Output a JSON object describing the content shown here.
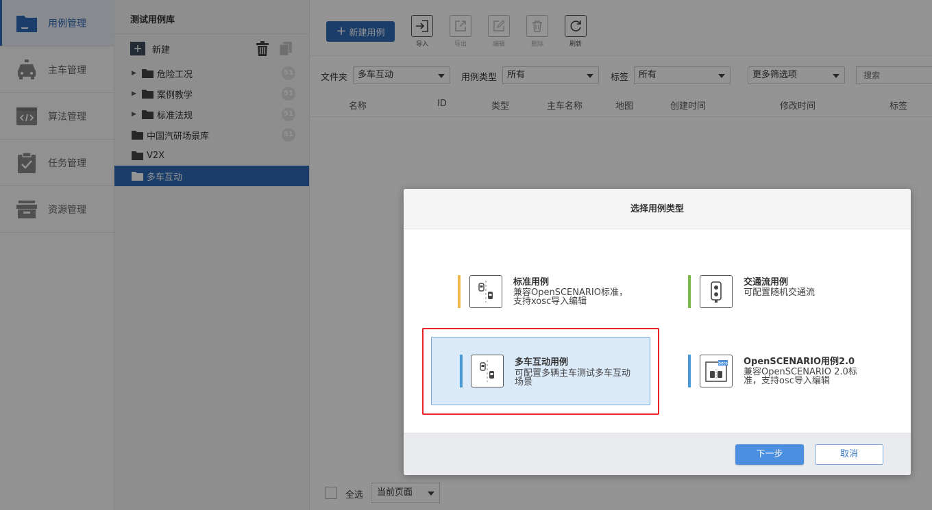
{
  "nav": {
    "items": [
      {
        "label": "用例管理",
        "icon": "folder-icon",
        "active": true
      },
      {
        "label": "主车管理",
        "icon": "car-icon",
        "active": false
      },
      {
        "label": "算法管理",
        "icon": "code-icon",
        "active": false
      },
      {
        "label": "任务管理",
        "icon": "clipboard-check-icon",
        "active": false
      },
      {
        "label": "资源管理",
        "icon": "archive-box-icon",
        "active": false
      }
    ]
  },
  "tree": {
    "title": "测试用例库",
    "new_label": "新建",
    "items": [
      {
        "label": "危险工况",
        "badge": "51",
        "expandable": true
      },
      {
        "label": "案例教学",
        "badge": "51",
        "expandable": true
      },
      {
        "label": "标准法规",
        "badge": "51",
        "expandable": true
      },
      {
        "label": "中国汽研场景库",
        "badge": "51",
        "expandable": false
      },
      {
        "label": "V2X",
        "badge": "",
        "expandable": false
      },
      {
        "label": "多车互动",
        "badge": "",
        "expandable": false,
        "active": true
      }
    ]
  },
  "toolbar": {
    "new_case": "新建用例",
    "tools": [
      {
        "label": "导入",
        "icon": "import-icon",
        "enabled": true
      },
      {
        "label": "导出",
        "icon": "export-icon",
        "enabled": false
      },
      {
        "label": "编辑",
        "icon": "edit-icon",
        "enabled": false
      },
      {
        "label": "删除",
        "icon": "trash-icon",
        "enabled": false
      },
      {
        "label": "刷新",
        "icon": "refresh-icon",
        "enabled": true
      }
    ]
  },
  "filters": {
    "folder_label": "文件夹",
    "folder_value": "多车互动",
    "type_label": "用例类型",
    "type_value": "所有",
    "tag_label": "标签",
    "tag_value": "所有",
    "more_value": "更多筛选项",
    "search_placeholder": "搜索"
  },
  "table": {
    "columns": [
      "名称",
      "ID",
      "类型",
      "主车名称",
      "地图",
      "创建时间",
      "修改时间",
      "标签"
    ]
  },
  "footer": {
    "select_all": "全选",
    "page_scope": "当前页面"
  },
  "modal": {
    "title": "选择用例类型",
    "next": "下一步",
    "cancel": "取消",
    "options": [
      {
        "title": "标准用例",
        "desc": "兼容OpenSCENARIO标准，支持xosc导入编辑",
        "accent": "#f0b84a",
        "icon": "scenario-cars-icon"
      },
      {
        "title": "交通流用例",
        "desc": "可配置随机交通流",
        "accent": "#7cb848",
        "icon": "traffic-light-icon"
      },
      {
        "title": "多车互动用例",
        "desc": "可配置多辆主车测试多车互动场景",
        "accent": "#4a9ad8",
        "icon": "multi-car-icon",
        "selected": true
      },
      {
        "title": "OpenSCENARIO用例2.0",
        "desc": "兼容OpenSCENARIO 2.0标准，支持osc导入编辑",
        "accent": "#4a9ad8",
        "icon": "openscenario-beta-icon",
        "badge": "beta"
      }
    ]
  }
}
